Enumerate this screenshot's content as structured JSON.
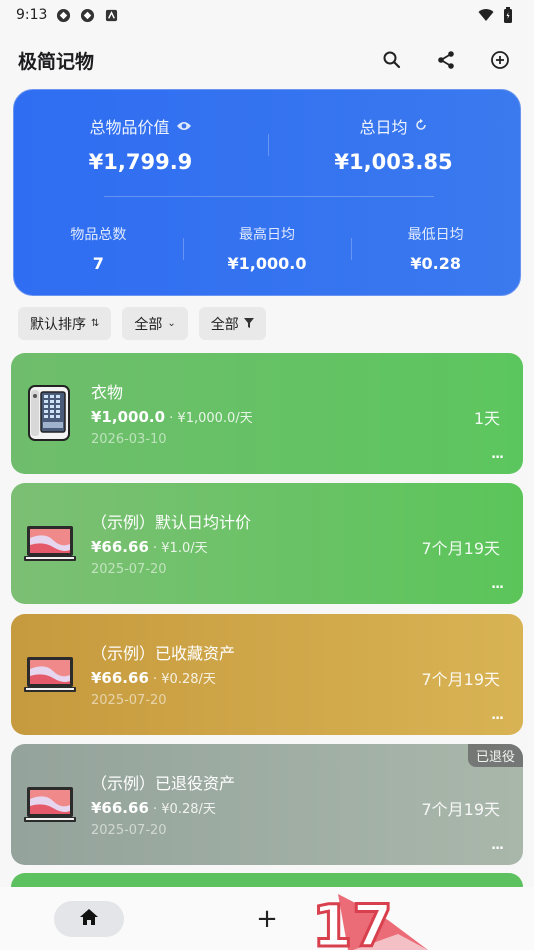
{
  "status_bar": {
    "time": "9:13"
  },
  "app": {
    "title": "极简记物",
    "icons": [
      "search-icon",
      "share-icon",
      "add-circle-icon"
    ]
  },
  "summary": {
    "total_value_label": "总物品价值",
    "total_value": "¥1,799.9",
    "daily_avg_label": "总日均",
    "daily_avg": "¥1,003.85",
    "count_label": "物品总数",
    "count": "7",
    "max_daily_label": "最高日均",
    "max_daily": "¥1,000.0",
    "min_daily_label": "最低日均",
    "min_daily": "¥0.28"
  },
  "filters": [
    {
      "label": "默认排序",
      "icon": "sort-icon"
    },
    {
      "label": "全部",
      "icon": "chevron-down-icon"
    },
    {
      "label": "全部",
      "icon": "filter-icon"
    }
  ],
  "items": [
    {
      "name": "衣物",
      "price": "¥1,000.0",
      "daily": " · ¥1,000.0/天",
      "date": "2026-03-10",
      "days": "1天",
      "more": "...",
      "color": "#5cc65e",
      "thumb": "phone"
    },
    {
      "name": "（示例）默认日均计价",
      "price": "¥66.66",
      "daily": " · ¥1.0/天",
      "date": "2025-07-20",
      "days": "7个月19天",
      "more": "...",
      "color": "#5bc55a",
      "thumb": "laptop"
    },
    {
      "name": "（示例）已收藏资产",
      "price": "¥66.66",
      "daily": " · ¥0.28/天",
      "date": "2025-07-20",
      "days": "7个月19天",
      "more": "...",
      "color": "#d8b354",
      "thumb": "laptop"
    },
    {
      "name": "（示例）已退役资产",
      "price": "¥66.66",
      "daily": " · ¥0.28/天",
      "date": "2025-07-20",
      "days": "7个月19天",
      "more": "...",
      "color": "#a9b7ab",
      "thumb": "laptop",
      "tag": "已退役"
    }
  ],
  "bottom_nav": {
    "home_icon": "home-icon",
    "add_label": "+",
    "badge_text": "17"
  }
}
